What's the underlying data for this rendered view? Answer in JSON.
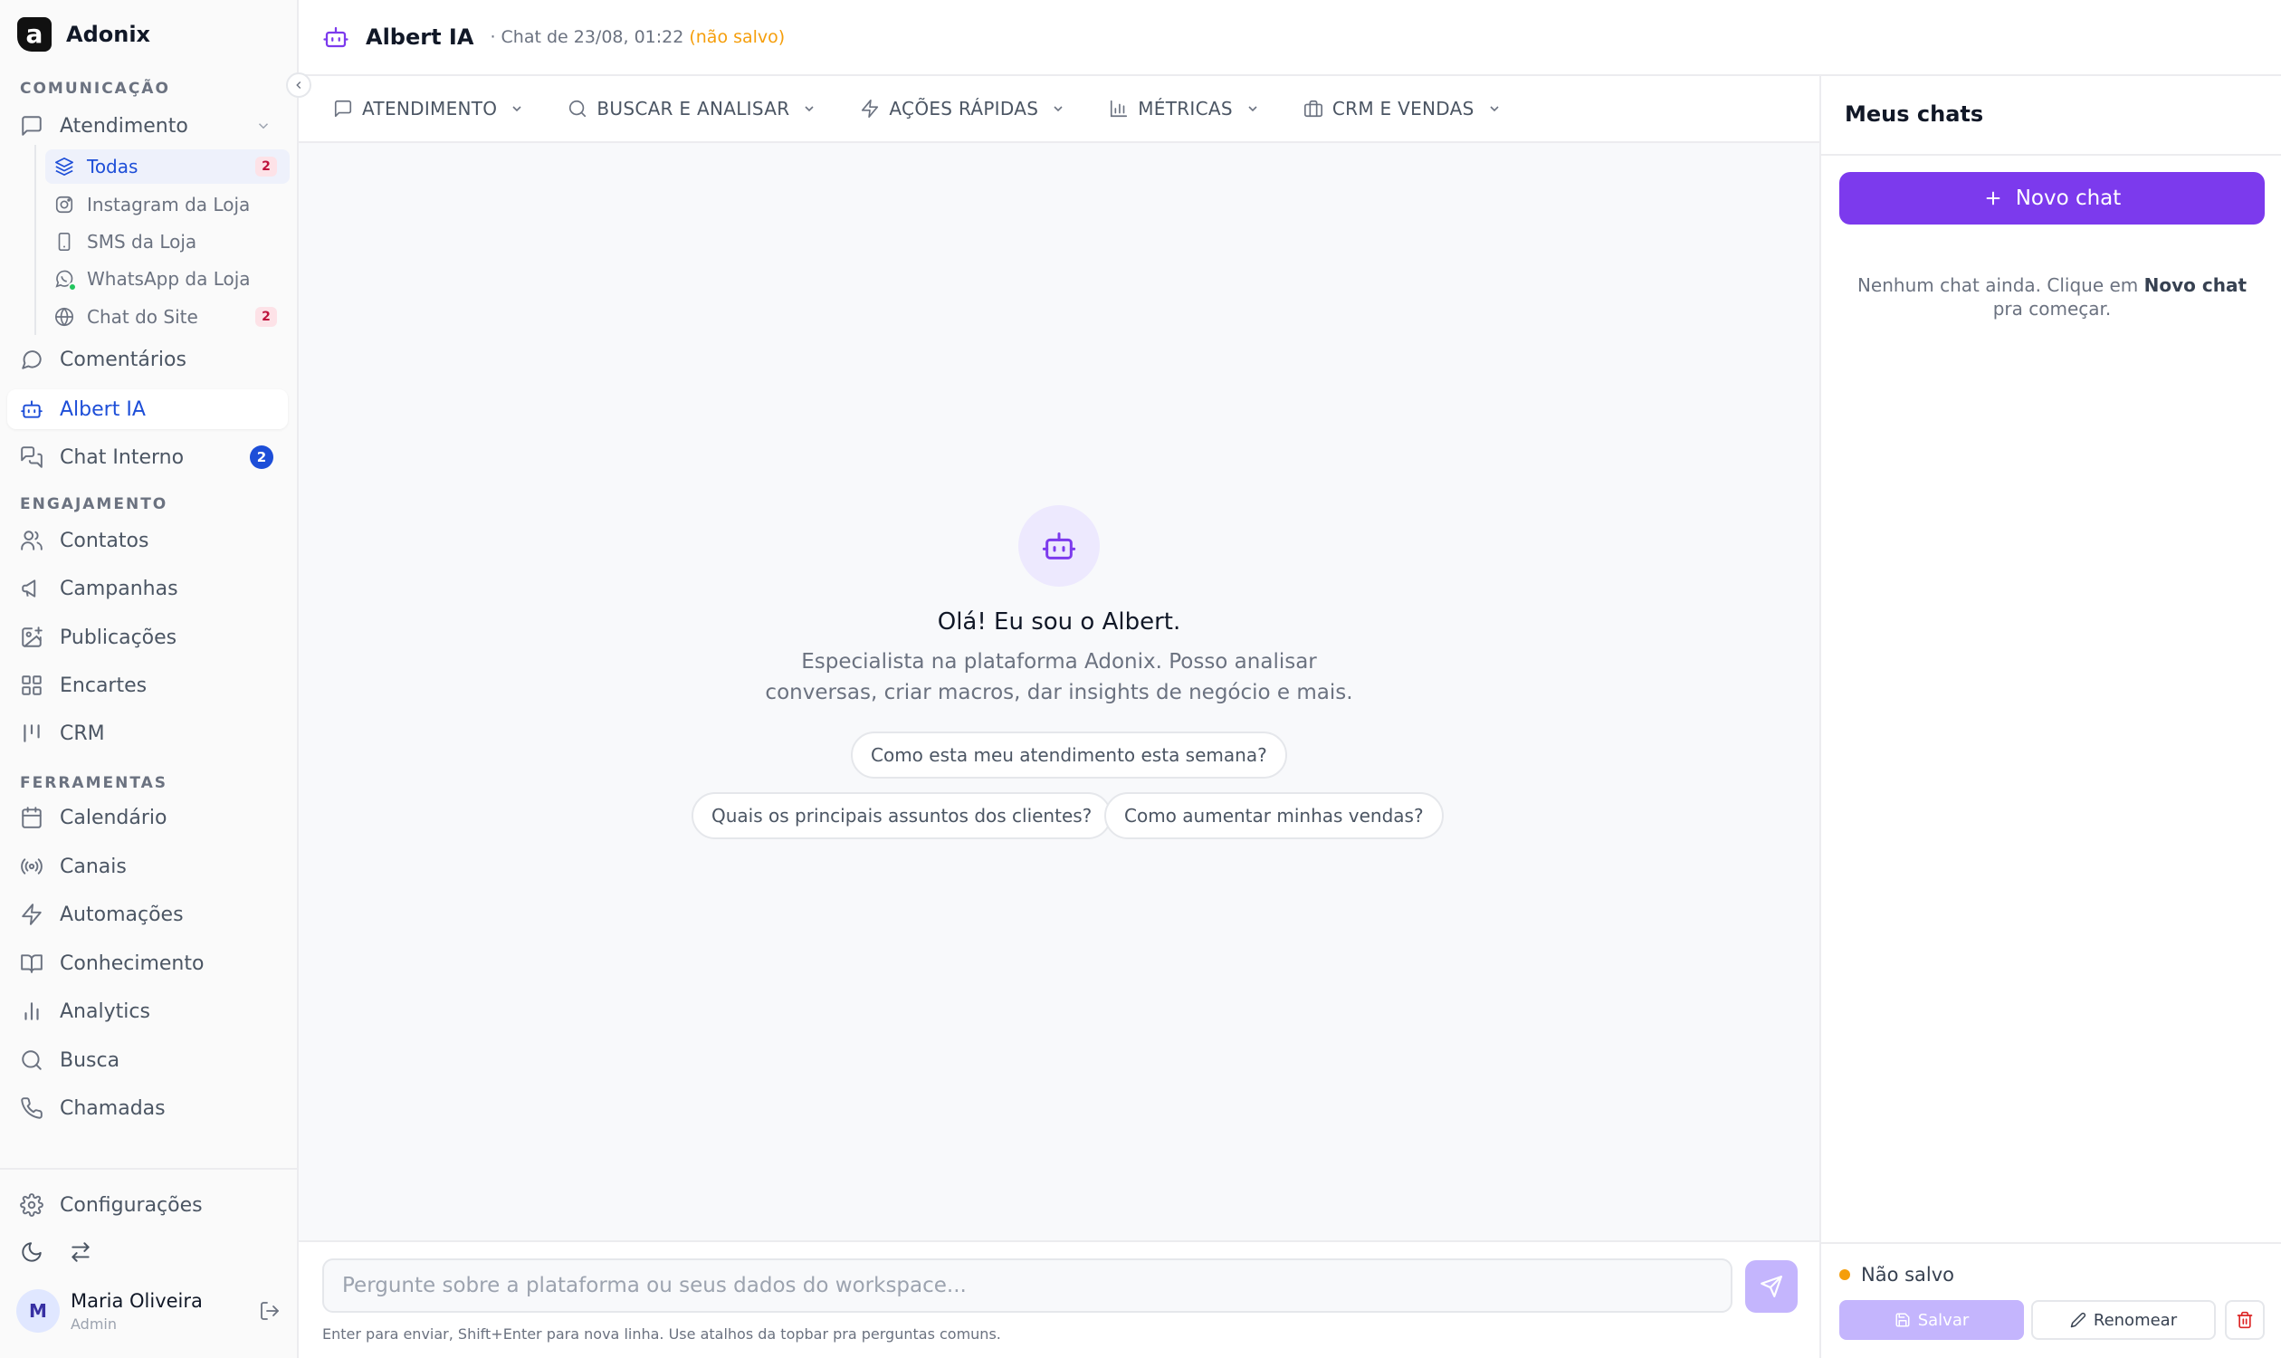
{
  "app": {
    "name": "Adonix",
    "logo_letter": "a"
  },
  "sidebar": {
    "section_comunicacao": "COMUNICAÇÃO",
    "atendimento": {
      "label": "Atendimento",
      "icon": "message-square-icon"
    },
    "sub_items": [
      {
        "label": "Todas",
        "icon": "layers-icon",
        "badge": "2",
        "active": true
      },
      {
        "label": "Instagram da Loja",
        "icon": "instagram-icon"
      },
      {
        "label": "SMS da Loja",
        "icon": "smartphone-icon"
      },
      {
        "label": "WhatsApp da Loja",
        "icon": "whatsapp-icon"
      },
      {
        "label": "Chat do Site",
        "icon": "globe-icon",
        "badge": "2"
      }
    ],
    "comentarios": "Comentários",
    "albert": "Albert IA",
    "chat_interno": {
      "label": "Chat Interno",
      "badge": "2"
    },
    "section_engajamento": "ENGAJAMENTO",
    "engajamento": [
      "Contatos",
      "Campanhas",
      "Publicações",
      "Encartes",
      "CRM"
    ],
    "section_ferramentas": "FERRAMENTAS",
    "ferramentas": [
      "Calendário",
      "Canais",
      "Automações",
      "Conhecimento",
      "Analytics",
      "Busca",
      "Chamadas"
    ],
    "configuracoes": "Configurações",
    "user": {
      "initial": "M",
      "name": "Maria Oliveira",
      "role": "Admin"
    }
  },
  "header": {
    "title": "Albert IA",
    "subtitle": "· Chat de 23/08, 01:22",
    "unsaved": "(não salvo)"
  },
  "topbar": [
    "ATENDIMENTO",
    "BUSCAR E ANALISAR",
    "AÇÕES RÁPIDAS",
    "MÉTRICAS",
    "CRM E VENDAS"
  ],
  "main": {
    "greeting": "Olá! Eu sou o Albert.",
    "description": "Especialista na plataforma Adonix. Posso analisar conversas, criar macros, dar insights de negócio e mais.",
    "suggestions": [
      "Como esta meu atendimento esta semana?",
      "Quais os principais assuntos dos clientes?",
      "Como aumentar minhas vendas?"
    ]
  },
  "composer": {
    "placeholder": "Pergunte sobre a plataforma ou seus dados do workspace...",
    "value": "",
    "hint": "Enter para enviar, Shift+Enter para nova linha. Use atalhos da topbar pra perguntas comuns."
  },
  "right_panel": {
    "title": "Meus chats",
    "new_chat": "Novo chat",
    "empty_prefix": "Nenhum chat ainda. Clique em",
    "empty_bold": "Novo chat",
    "empty_suffix": "pra começar.",
    "status": "Não salvo",
    "save": "Salvar",
    "rename": "Renomear"
  },
  "colors": {
    "accent": "#7c3aed",
    "active_blue": "#1d4ed8",
    "unsaved": "#f59e0b"
  }
}
